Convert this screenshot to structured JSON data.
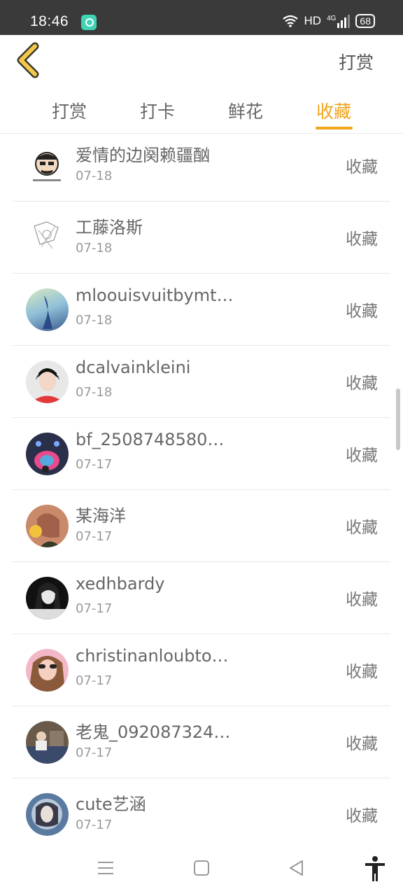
{
  "status_bar": {
    "time": "18:46",
    "network": "HD",
    "signal": "4G",
    "battery": "68"
  },
  "header": {
    "title_action": "打赏"
  },
  "tabs": [
    {
      "label": "打赏",
      "active": false
    },
    {
      "label": "打卡",
      "active": false
    },
    {
      "label": "鲜花",
      "active": false
    },
    {
      "label": "收藏",
      "active": true
    }
  ],
  "accent_color": "#f0a41a",
  "items": [
    {
      "name": "爱情的边阕赖疆酗",
      "date": "07-18",
      "action": "收藏"
    },
    {
      "name": "工藤洛斯",
      "date": "07-18",
      "action": "收藏"
    },
    {
      "name": "mloouisvuitbymt…",
      "date": "07-18",
      "action": "收藏"
    },
    {
      "name": "dcalvainkleini",
      "date": "07-18",
      "action": "收藏"
    },
    {
      "name": "bf_2508748580…",
      "date": "07-17",
      "action": "收藏"
    },
    {
      "name": "某海洋",
      "date": "07-17",
      "action": "收藏"
    },
    {
      "name": "xedhbardy",
      "date": "07-17",
      "action": "收藏"
    },
    {
      "name": "christinanloubto…",
      "date": "07-17",
      "action": "收藏"
    },
    {
      "name": "老鬼_092087324…",
      "date": "07-17",
      "action": "收藏"
    },
    {
      "name": "cute艺涵",
      "date": "07-17",
      "action": "收藏"
    }
  ],
  "nav_icons": [
    "menu-icon",
    "home-icon",
    "back-triangle-icon",
    "accessibility-icon"
  ]
}
